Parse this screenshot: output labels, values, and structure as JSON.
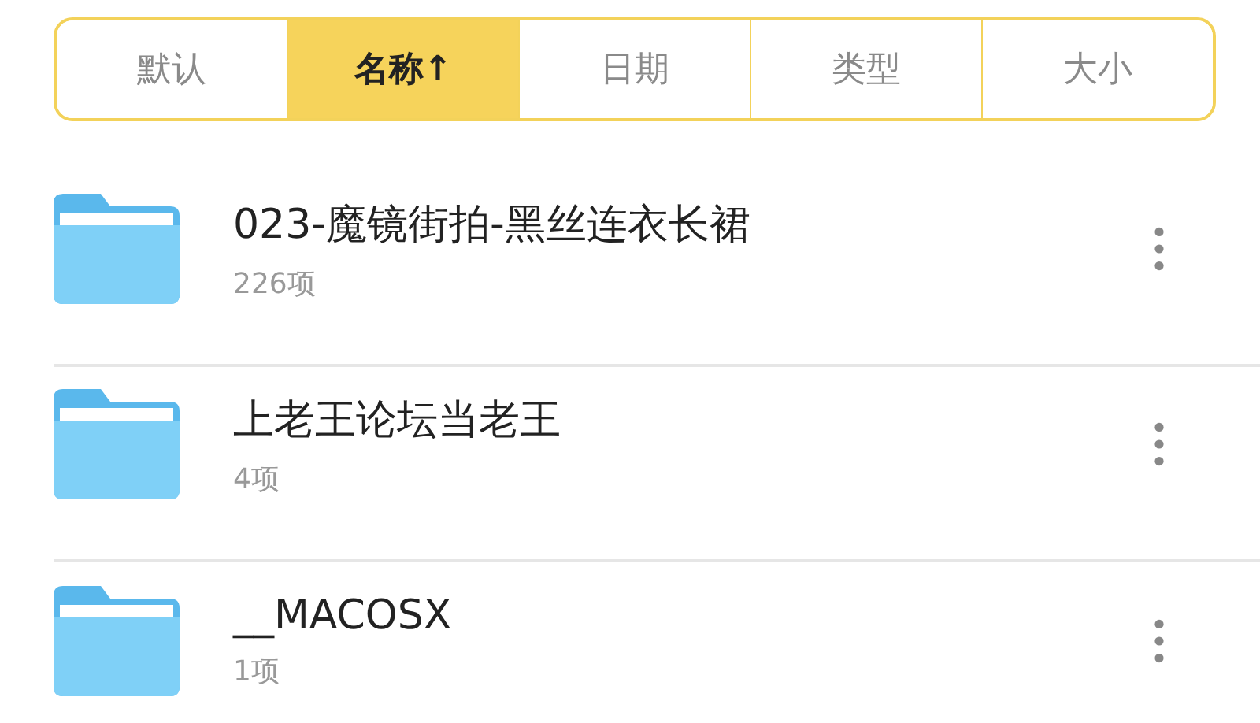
{
  "sort_tabs": [
    {
      "label": "默认",
      "selected": false
    },
    {
      "label": "名称↑",
      "selected": true
    },
    {
      "label": "日期",
      "selected": false
    },
    {
      "label": "类型",
      "selected": false
    },
    {
      "label": "大小",
      "selected": false
    }
  ],
  "folders": [
    {
      "name": "023-魔镜街拍-黑丝连衣长裙",
      "count": "226项"
    },
    {
      "name": "上老王论坛当老王",
      "count": "4项"
    },
    {
      "name": "__MACOSX",
      "count": "1项"
    }
  ]
}
